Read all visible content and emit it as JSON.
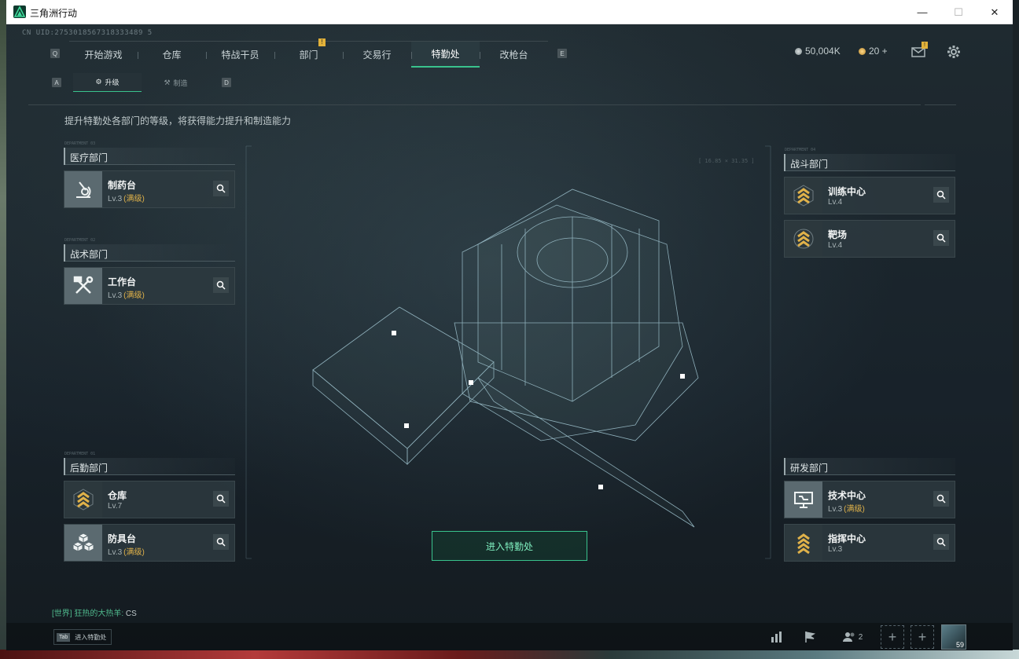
{
  "window": {
    "title": "三角洲行动",
    "minimize": "—",
    "maximize": "☐",
    "close": "✕"
  },
  "uid": "CN UID:2753018567318333489 5",
  "nav": {
    "left_key": "Q",
    "right_key": "E",
    "tabs": [
      {
        "label": "开始游戏"
      },
      {
        "label": "仓库"
      },
      {
        "label": "特战干员"
      },
      {
        "label": "部门",
        "badge": "!"
      },
      {
        "label": "交易行"
      },
      {
        "label": "特勤处"
      },
      {
        "label": "改枪台"
      }
    ]
  },
  "currency": {
    "money": "50,004K",
    "gold": "20 +"
  },
  "mail_badge": "!",
  "subtabs": {
    "left_key": "A",
    "right_key": "D",
    "items": [
      {
        "label": "升级"
      },
      {
        "label": "制造"
      }
    ]
  },
  "description": "提升特勤处各部门的等级，将获得能力提升和制造能力",
  "departments": {
    "medical": {
      "tag": "DEPARTMENT 03",
      "title": "医疗部门",
      "items": [
        {
          "name": "制药台",
          "level": "Lv.3",
          "maxed": "(满级)"
        }
      ]
    },
    "tactical": {
      "tag": "DEPARTMENT 02",
      "title": "战术部门",
      "items": [
        {
          "name": "工作台",
          "level": "Lv.3",
          "maxed": "(满级)"
        }
      ]
    },
    "logistics": {
      "tag": "DEPARTMENT 01",
      "title": "后勤部门",
      "items": [
        {
          "name": "仓库",
          "level": "Lv.7"
        },
        {
          "name": "防具台",
          "level": "Lv.3",
          "maxed": "(满级)"
        }
      ]
    },
    "combat": {
      "tag": "DEPARTMENT 04",
      "title": "战斗部门",
      "items": [
        {
          "name": "训练中心",
          "level": "Lv.4"
        },
        {
          "name": "靶场",
          "level": "Lv.4"
        }
      ]
    },
    "research": {
      "tag": "DEPARTMENT 05",
      "title": "研发部门",
      "items": [
        {
          "name": "技术中心",
          "level": "Lv.3",
          "maxed": "(满级)"
        },
        {
          "name": "指挥中心",
          "level": "Lv.3"
        }
      ]
    }
  },
  "enter_button": "进入特勤处",
  "chat": {
    "channel": "[世界]",
    "sender": "狂热的大热羊:",
    "message": "CS"
  },
  "bottom": {
    "tab_key": "Tab",
    "tab_hint": "进入特勤处",
    "party_count": "2",
    "player_level": "59"
  },
  "colors": {
    "accent": "#39c38d",
    "gold": "#e0b24a",
    "badge": "#e2b23a"
  }
}
